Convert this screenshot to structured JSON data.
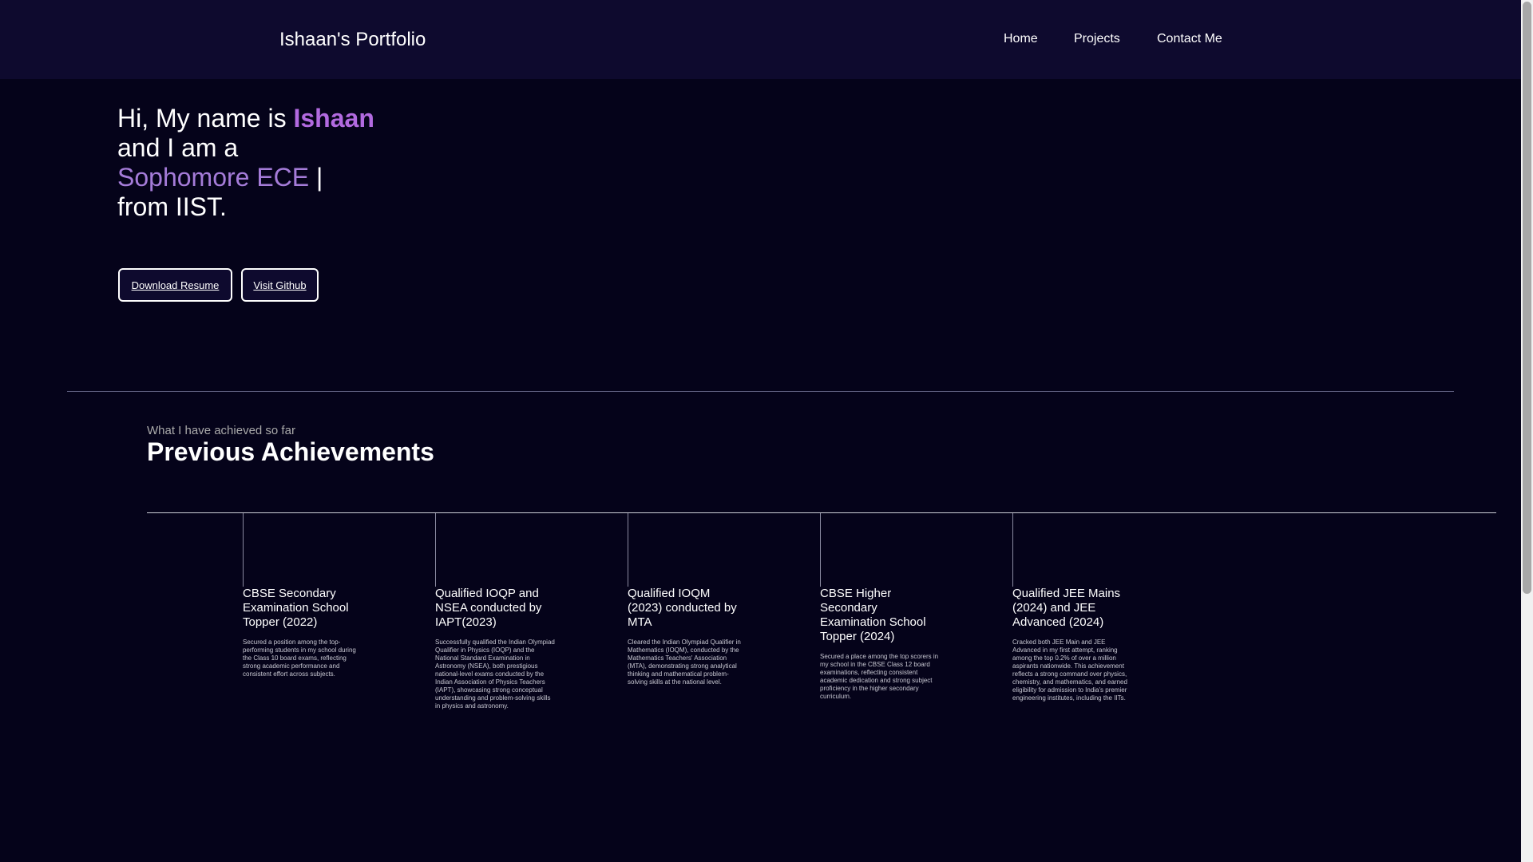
{
  "navbar": {
    "brand": "Ishaan's Portfolio",
    "links": [
      "Home",
      "Projects",
      "Contact Me"
    ]
  },
  "hero": {
    "line1_prefix": "Hi, My name is ",
    "line1_name": "Ishaan",
    "line2": "and I am a",
    "line3_accent": "Sophomore ECE",
    "line3_suffix": " |",
    "line4": "from IIST.",
    "download_label": "Download Resume",
    "github_label": "Visit Github"
  },
  "achievements": {
    "subheading": "What I have achieved so far",
    "heading": "Previous Achievements",
    "cards": [
      {
        "title": "CBSE Secondary Examination School Topper (2022)",
        "description": "Secured a position among the top-performing students in my school during the Class 10 board exams, reflecting strong academic performance and consistent effort across subjects."
      },
      {
        "title": "Qualified IOQP and NSEA conducted by IAPT(2023)",
        "description": "Successfully qualified the Indian Olympiad Qualifier in Physics (IOQP) and the National Standard Examination in Astronomy (NSEA), both prestigious national-level exams conducted by the Indian Association of Physics Teachers (IAPT), showcasing strong conceptual understanding and problem-solving skills in physics and astronomy."
      },
      {
        "title": "Qualified IOQM (2023) conducted by MTA",
        "description": "Cleared the Indian Olympiad Qualifier in Mathematics (IOQM), conducted by the Mathematics Teachers' Association (MTA), demonstrating strong analytical thinking and mathematical problem-solving skills at the national level."
      },
      {
        "title": "CBSE Higher Secondary Examination School Topper (2024)",
        "description": "Secured a place among the top scorers in my school in the CBSE Class 12 board examinations, reflecting consistent academic dedication and strong subject proficiency in the higher secondary curriculum."
      },
      {
        "title": "Qualified JEE Mains (2024) and JEE Advanced (2024)",
        "description": "Cracked both JEE Main and JEE Advanced in my first attempt, ranking among the top 0.2% of over a million aspirants nationwide. This achievement reflects a strong command over physics, chemistry, and mathematics, and earned eligibility for admission to India's premier engineering institutes, including the IITs."
      }
    ]
  },
  "colors": {
    "background": "#05031a",
    "navbar": "#0e0a2e",
    "accent": "#b26ae0"
  }
}
